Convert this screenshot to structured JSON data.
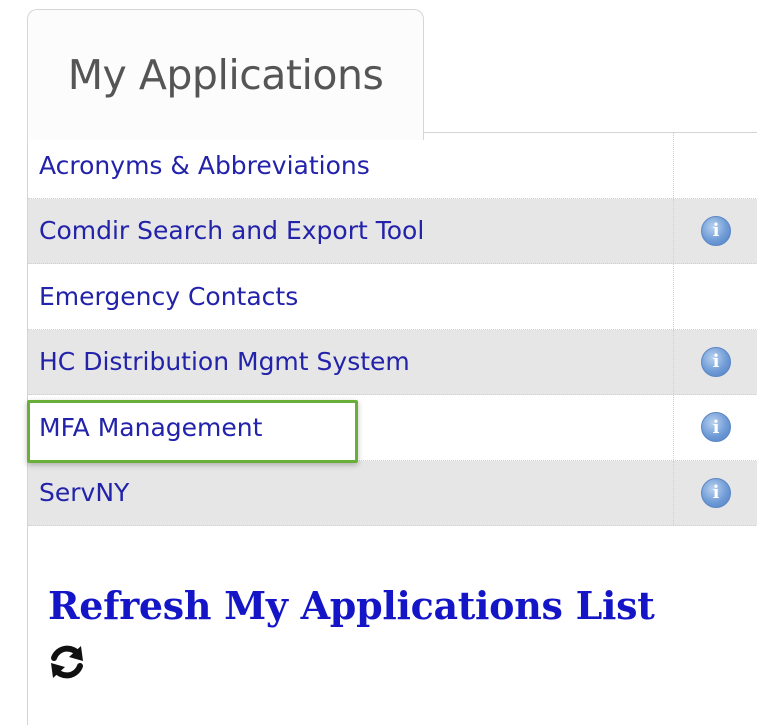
{
  "tab": {
    "label": "My Applications"
  },
  "applications": [
    {
      "label": "Acronyms & Abbreviations",
      "has_info": false
    },
    {
      "label": "Comdir Search and Export Tool",
      "has_info": true
    },
    {
      "label": "Emergency Contacts",
      "has_info": false
    },
    {
      "label": "HC Distribution Mgmt System",
      "has_info": true
    },
    {
      "label": "MFA Management",
      "has_info": true,
      "highlighted": true
    },
    {
      "label": "ServNY",
      "has_info": true
    }
  ],
  "info_icon": {
    "glyph": "i",
    "name": "info-icon"
  },
  "refresh": {
    "label": "Refresh My Applications List",
    "icon": "refresh-icon"
  },
  "colors": {
    "link": "#2222aa",
    "refresh_link": "#1515c8",
    "highlight_border": "#6aae3a",
    "alt_row": "#e6e6e6"
  }
}
